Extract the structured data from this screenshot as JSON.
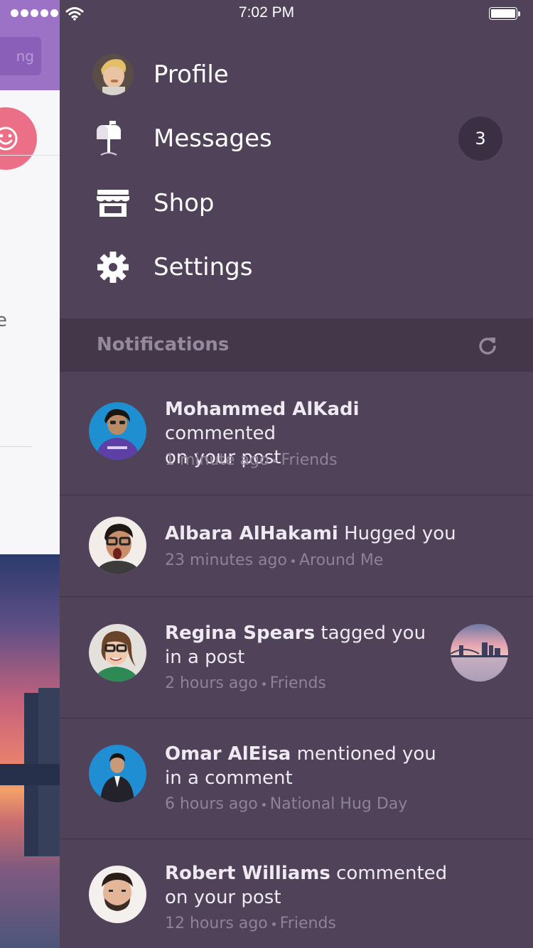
{
  "status_bar": {
    "time": "7:02 PM"
  },
  "background_app": {
    "header_button_partial": "ng",
    "partial_text": "e"
  },
  "menu": {
    "items": [
      {
        "label": "Profile",
        "icon": "profile-avatar"
      },
      {
        "label": "Messages",
        "icon": "mailbox-icon",
        "badge": "3"
      },
      {
        "label": "Shop",
        "icon": "shop-icon"
      },
      {
        "label": "Settings",
        "icon": "gear-icon"
      }
    ]
  },
  "notifications": {
    "title": "Notifications",
    "items": [
      {
        "name": "Mohammed AlKadi",
        "action": "commented",
        "action2": "on your post",
        "time": "1 minute ago",
        "group": "Friends"
      },
      {
        "name": "Albara AlHakami",
        "action": "Hugged you",
        "action2": "",
        "time": "23 minutes ago",
        "group": "Around Me"
      },
      {
        "name": "Regina Spears",
        "action": "tagged you",
        "action2": "in a post",
        "time": "2 hours ago",
        "group": "Friends"
      },
      {
        "name": "Omar AlEisa",
        "action": "mentioned you",
        "action2": "in a comment",
        "time": "6 hours ago",
        "group": "National Hug Day"
      },
      {
        "name": "Robert Williams",
        "action": "commented",
        "action2": "on your post",
        "time": "12 hours ago",
        "group": "Friends"
      }
    ]
  },
  "colors": {
    "drawer": "#4f4259",
    "notif_header": "#433749",
    "accent": "#9b72c6",
    "badge": "#3a2f43"
  }
}
